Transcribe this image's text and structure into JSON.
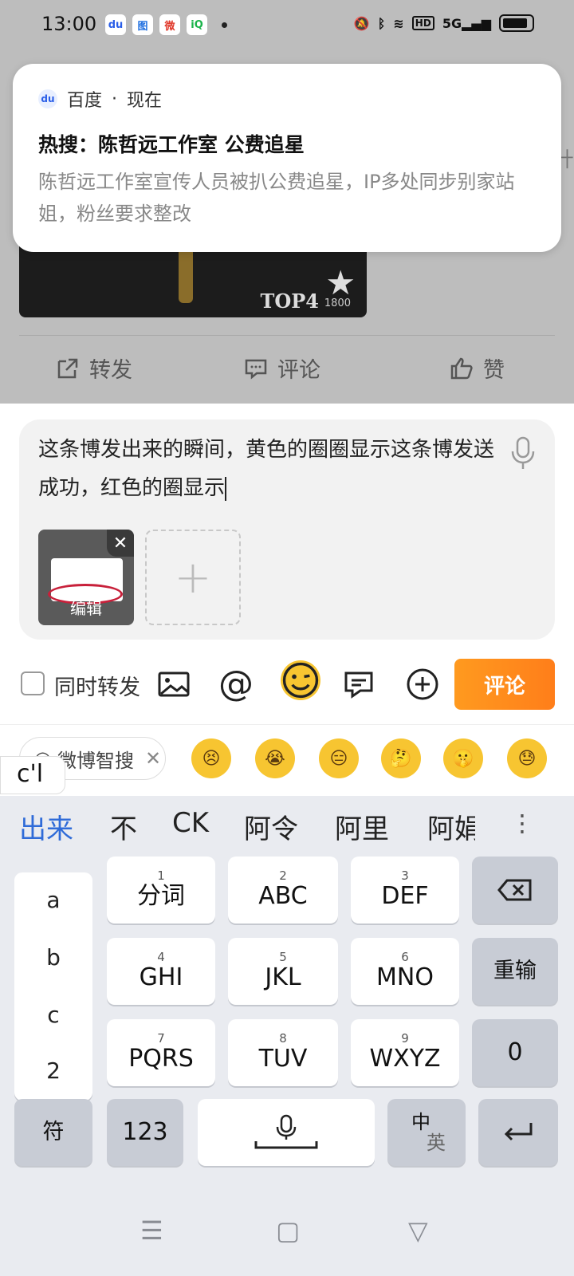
{
  "status": {
    "time": "13:00",
    "apps": [
      "du",
      "图",
      "微",
      "iQ"
    ],
    "hd": "HD",
    "net": "5G"
  },
  "background_post": {
    "image_badge": "TOP4",
    "image_count": "1800",
    "actions": {
      "share": "转发",
      "comment": "评论",
      "like": "赞"
    }
  },
  "notification": {
    "app_name": "百度",
    "time": "现在",
    "title": "热搜：陈哲远工作室 公费追星",
    "body": "陈哲远工作室宣传人员被扒公费追星，IP多处同步别家站姐，粉丝要求整改"
  },
  "composer": {
    "text": "这条博发出来的瞬间，黄色的圈圈显示这条博发送成功，红色的圈显示",
    "attachment_label": "编辑"
  },
  "toolbar": {
    "repost_checkbox_label": "同时转发",
    "at_symbol": "@",
    "submit_label": "评论"
  },
  "emoji_bar": {
    "search_chip": "微博智搜",
    "emojis": [
      "😣",
      "😭",
      "😑",
      "🤔",
      "🤫",
      "😓"
    ]
  },
  "ime": {
    "preedit": "c'l",
    "candidates": [
      "出来",
      "不",
      "CK",
      "阿令",
      "阿里",
      "阿娟"
    ],
    "side_letters": [
      "a",
      "b",
      "c",
      "2"
    ],
    "keys": [
      {
        "num": "1",
        "label": "分词"
      },
      {
        "num": "2",
        "label": "ABC"
      },
      {
        "num": "3",
        "label": "DEF"
      },
      {
        "num": "4",
        "label": "GHI"
      },
      {
        "num": "5",
        "label": "JKL"
      },
      {
        "num": "6",
        "label": "MNO"
      },
      {
        "num": "7",
        "label": "PQRS"
      },
      {
        "num": "8",
        "label": "TUV"
      },
      {
        "num": "9",
        "label": "WXYZ"
      }
    ],
    "reinput": "重输",
    "zero": "0",
    "symbol": "符",
    "numeric": "123",
    "lang_top": "中",
    "lang_bottom": "英"
  }
}
